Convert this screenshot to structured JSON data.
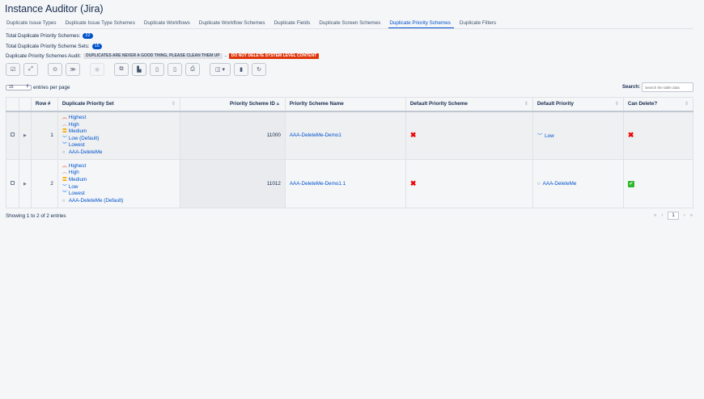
{
  "title": "Instance Auditor (Jira)",
  "tabs": [
    "Duplicate Issue Types",
    "Duplicate Issue Type Schemes",
    "Duplicate Workflows",
    "Duplicate Workflow Schemes",
    "Duplicate Fields",
    "Duplicate Screen Schemes",
    "Duplicate Priority Schemes",
    "Duplicate Filters"
  ],
  "active_tab": "Duplicate Priority Schemes",
  "stats": {
    "schemes_label": "Total Duplicate Priority Schemes:",
    "schemes_count": "22",
    "sets_label": "Total Duplicate Priority Scheme Sets:",
    "sets_count": "15",
    "audit_label": "Duplicate Priority Schemes Audit:",
    "audit_note": "DUPLICATES ARE NEVER A GOOD THING, PLEASE CLEAN THEM UP",
    "sep": "-",
    "audit_warning": "DO NOT DELETE SYSTEM LEVEL CONTENT"
  },
  "length": {
    "value": "15",
    "label": "entries per page"
  },
  "search": {
    "label": "Search:",
    "placeholder": "Search the table data"
  },
  "columns": [
    "Row #",
    "Duplicate Priority Set",
    "Priority Scheme ID",
    "Priority Scheme Name",
    "Default Priority Scheme",
    "Default Priority",
    "Can Delete?"
  ],
  "rows": [
    {
      "row": "1",
      "set": [
        "Highest",
        "High",
        "Medium",
        "Low (Default)",
        "Lowest",
        "AAA-DeleteMe"
      ],
      "id": "11000",
      "name": "AAA-DeleteMe-Demo1",
      "default_scheme": "✖",
      "default_priority": "Low",
      "default_priority_icon": "﹀",
      "can_delete": "✖"
    },
    {
      "row": "2",
      "set": [
        "Highest",
        "High",
        "Medium",
        "Low",
        "Lowest",
        "AAA-DeleteMe (Default)"
      ],
      "id": "11012",
      "name": "AAA-DeleteMe-Demo1.1",
      "default_scheme": "✖",
      "default_priority": "AAA-DeleteMe",
      "default_priority_icon": "○",
      "can_delete": "✔"
    }
  ],
  "priority_icons": [
    "︽",
    "︿",
    "〓",
    "﹀",
    "︾",
    "○"
  ],
  "priority_colors": [
    "#ff5630",
    "#ff7452",
    "#ffab00",
    "#0065ff",
    "#2684ff",
    "#6b778c"
  ],
  "info": "Showing 1 to 2 of 2 entries",
  "pager": {
    "first": "«",
    "prev": "‹",
    "current": "1",
    "next": "›",
    "last": "»"
  }
}
